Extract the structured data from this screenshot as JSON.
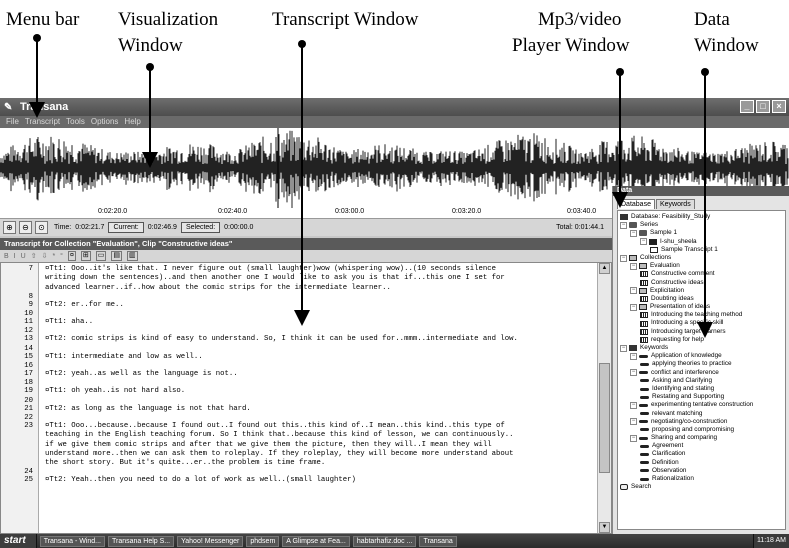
{
  "annotations": {
    "menu_bar": "Menu bar",
    "visualization_line1": "Visualization",
    "visualization_line2": "Window",
    "transcript": "Transcript Window",
    "player_line1": "Mp3/video",
    "player_line2": "Player Window",
    "data_line1": "Data",
    "data_line2": "Window"
  },
  "window": {
    "title": "Transana",
    "menu": [
      "File",
      "Transcript",
      "Tools",
      "Options",
      "Help"
    ]
  },
  "timeline": {
    "ticks": [
      "0:02:20.0",
      "0:02:40.0",
      "0:03:00.0",
      "0:03:20.0",
      "0:03:40.0"
    ],
    "time_label": "Time:",
    "time_value": "0:02:21.7",
    "current_label": "Current:",
    "current_value": "0:02:46.9",
    "selected_label": "Selected:",
    "selected_value": "0:00:00.0",
    "total_label": "Total:",
    "total_value": "0:01:44.1"
  },
  "transcript": {
    "title": "Transcript for Collection \"Evaluation\", Clip \"Constructive ideas\"",
    "toolbar": [
      "B",
      "I",
      "U",
      "⇧",
      "⇩",
      "*",
      "°",
      "¤",
      "⊞",
      "▭",
      "▤",
      "▥"
    ],
    "lines": [
      {
        "n": "7",
        "text": "¤Tt1: Ooo..it's like that. I never figure out (small laughter)wow (whispering wow)..(10 seconds silence"
      },
      {
        "n": "",
        "text": "writing down the sentences)..and then another one I would like to ask you is that if...this one I set for"
      },
      {
        "n": "",
        "text": "advanced learner..if..how about the comic strips for the intermediate learner.."
      },
      {
        "n": "8",
        "text": ""
      },
      {
        "n": "9",
        "text": "¤Tt2: er..for me.."
      },
      {
        "n": "10",
        "text": ""
      },
      {
        "n": "11",
        "text": "¤Tt1: aha.."
      },
      {
        "n": "12",
        "text": ""
      },
      {
        "n": "13",
        "text": "¤Tt2: comic strips is kind of easy to understand. So, I think it can be used for..mmm..intermediate and low."
      },
      {
        "n": "14",
        "text": ""
      },
      {
        "n": "15",
        "text": "¤Tt1: intermediate and low as well.."
      },
      {
        "n": "16",
        "text": ""
      },
      {
        "n": "17",
        "text": "¤Tt2: yeah..as well as the language is not.."
      },
      {
        "n": "18",
        "text": ""
      },
      {
        "n": "19",
        "text": "¤Tt1: oh yeah..is not hard also."
      },
      {
        "n": "20",
        "text": ""
      },
      {
        "n": "21",
        "text": "¤Tt2: as long as the language is not that hard."
      },
      {
        "n": "22",
        "text": ""
      },
      {
        "n": "23",
        "text": "¤Tt1: Ooo...because..because I found out..I found out this..this kind of..I mean..this kind..this type of"
      },
      {
        "n": "",
        "text": "teaching in the English teaching forum. So I think that..because this kind of lesson, we can continuously.."
      },
      {
        "n": "",
        "text": "if we give them comic strips and after that we give them the picture, then they will..I mean they will"
      },
      {
        "n": "",
        "text": "understand more..then we can ask them to roleplay. If they roleplay, they will become more understand about"
      },
      {
        "n": "",
        "text": "the short story. But it's quite...er..the problem is time frame."
      },
      {
        "n": "24",
        "text": ""
      },
      {
        "n": "25",
        "text": "¤Tt2: Yeah..then you need to do a lot of work as well..(small laughter)"
      }
    ]
  },
  "data_window": {
    "title": "Data",
    "tabs": [
      "Database",
      "Keywords"
    ],
    "tree": [
      {
        "depth": 0,
        "icon": "db",
        "label": "Database: Feasibility_Study"
      },
      {
        "depth": 0,
        "icon": "series",
        "label": "Series",
        "toggle": "−"
      },
      {
        "depth": 1,
        "icon": "series",
        "label": "Sample 1",
        "toggle": "−"
      },
      {
        "depth": 2,
        "icon": "episode",
        "label": "I-shu_sheela",
        "toggle": "−"
      },
      {
        "depth": 3,
        "icon": "doc",
        "label": "Sample Transcript 1"
      },
      {
        "depth": 0,
        "icon": "coll",
        "label": "Collections",
        "toggle": "−"
      },
      {
        "depth": 1,
        "icon": "coll",
        "label": "Evaluation",
        "toggle": "−"
      },
      {
        "depth": 2,
        "icon": "clip",
        "label": "Constructive comment"
      },
      {
        "depth": 2,
        "icon": "clip",
        "label": "Constructive ideas"
      },
      {
        "depth": 1,
        "icon": "coll",
        "label": "Explicitation",
        "toggle": "−"
      },
      {
        "depth": 2,
        "icon": "clip",
        "label": "Doubting ideas"
      },
      {
        "depth": 1,
        "icon": "coll",
        "label": "Presentation of ideas",
        "toggle": "−"
      },
      {
        "depth": 2,
        "icon": "clip",
        "label": "Introducing the teaching method"
      },
      {
        "depth": 2,
        "icon": "clip",
        "label": "Introducing a specific skill"
      },
      {
        "depth": 2,
        "icon": "clip",
        "label": "Introducing target learners"
      },
      {
        "depth": 2,
        "icon": "clip",
        "label": "requesting for help"
      },
      {
        "depth": 0,
        "icon": "db",
        "label": "Keywords",
        "toggle": "−"
      },
      {
        "depth": 1,
        "icon": "kw",
        "label": "Application of knowledge",
        "toggle": "−"
      },
      {
        "depth": 2,
        "icon": "kw",
        "label": "applying theories to practice"
      },
      {
        "depth": 1,
        "icon": "kw",
        "label": "conflict and interference",
        "toggle": "−"
      },
      {
        "depth": 2,
        "icon": "kw",
        "label": "Asking and Clarifying"
      },
      {
        "depth": 2,
        "icon": "kw",
        "label": "Identifying and stating"
      },
      {
        "depth": 2,
        "icon": "kw",
        "label": "Restating and Supporting"
      },
      {
        "depth": 1,
        "icon": "kw",
        "label": "experimenting tentative construction",
        "toggle": "−"
      },
      {
        "depth": 2,
        "icon": "kw",
        "label": "relevant matching"
      },
      {
        "depth": 1,
        "icon": "kw",
        "label": "negotiating/co-construction",
        "toggle": "−"
      },
      {
        "depth": 2,
        "icon": "kw",
        "label": "proposing and compromising"
      },
      {
        "depth": 1,
        "icon": "kw",
        "label": "Sharing and comparing",
        "toggle": "−"
      },
      {
        "depth": 2,
        "icon": "kw",
        "label": "Agreement"
      },
      {
        "depth": 2,
        "icon": "kw",
        "label": "Clarification"
      },
      {
        "depth": 2,
        "icon": "kw",
        "label": "Definition"
      },
      {
        "depth": 2,
        "icon": "kw",
        "label": "Observation"
      },
      {
        "depth": 2,
        "icon": "kw",
        "label": "Rationalization"
      },
      {
        "depth": 0,
        "icon": "search",
        "label": "Search"
      }
    ]
  },
  "taskbar": {
    "start": "start",
    "tasks": [
      "Transana - Wind...",
      "Transana Help S...",
      "Yahoo! Messenger",
      "phdsem",
      "A Glimpse at Fea...",
      "habtarhafiz.doc ...",
      "Transana"
    ],
    "clock": "11:18 AM"
  }
}
